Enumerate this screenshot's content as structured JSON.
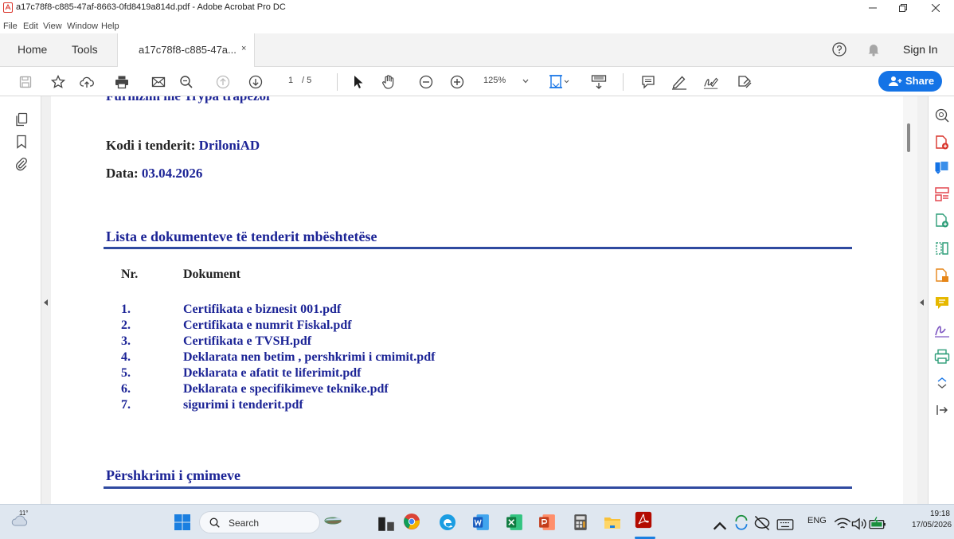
{
  "window": {
    "title": "a17c78f8-c885-47af-8663-0fd8419a814d.pdf - Adobe Acrobat Pro DC"
  },
  "menu": [
    "File",
    "Edit",
    "View",
    "Window",
    "Help"
  ],
  "tabs": {
    "home": "Home",
    "tools": "Tools",
    "doc_tab": "a17c78f8-c885-47a...",
    "close": "×"
  },
  "header_right": {
    "sign_in": "Sign In"
  },
  "toolbar": {
    "page_current": "1",
    "page_total": "/ 5",
    "zoom": "125%",
    "share_label": "Share"
  },
  "document": {
    "partial_top": "Furnizim me Trypa trapezoi",
    "tender_code_label": "Kodi i tenderit:",
    "tender_code_value": "DriloniAD",
    "date_label": "Data:",
    "date_value": "03.04.2026",
    "section_docs_title": "Lista e dokumenteve të tenderit mbështetëse",
    "col_nr": "Nr.",
    "col_doc": "Dokument",
    "items": [
      {
        "nr": "1.",
        "name": "Certifikata e biznesit 001.pdf"
      },
      {
        "nr": "2.",
        "name": "Certifikata e numrit Fiskal.pdf"
      },
      {
        "nr": "3.",
        "name": "Certifikata e TVSH.pdf"
      },
      {
        "nr": "4.",
        "name": "Deklarata nen betim , pershkrimi i cmimit.pdf"
      },
      {
        "nr": "5.",
        "name": "Deklarata e afatit te liferimit.pdf"
      },
      {
        "nr": "6.",
        "name": "Deklarata e specifikimeve teknike.pdf"
      },
      {
        "nr": "7.",
        "name": "sigurimi i tenderit.pdf"
      }
    ],
    "section_prices_title": "Përshkrimi i çmimeve"
  },
  "taskbar": {
    "weather_temp": "11°",
    "search_label": "Search",
    "lang": "ENG",
    "time": "19:18",
    "date": "17/05/2026"
  },
  "colors": {
    "accent": "#1473e6",
    "doc_blue": "#1c2496",
    "rule_blue": "#2f4aa0",
    "acrobat_red": "#d9342b"
  }
}
